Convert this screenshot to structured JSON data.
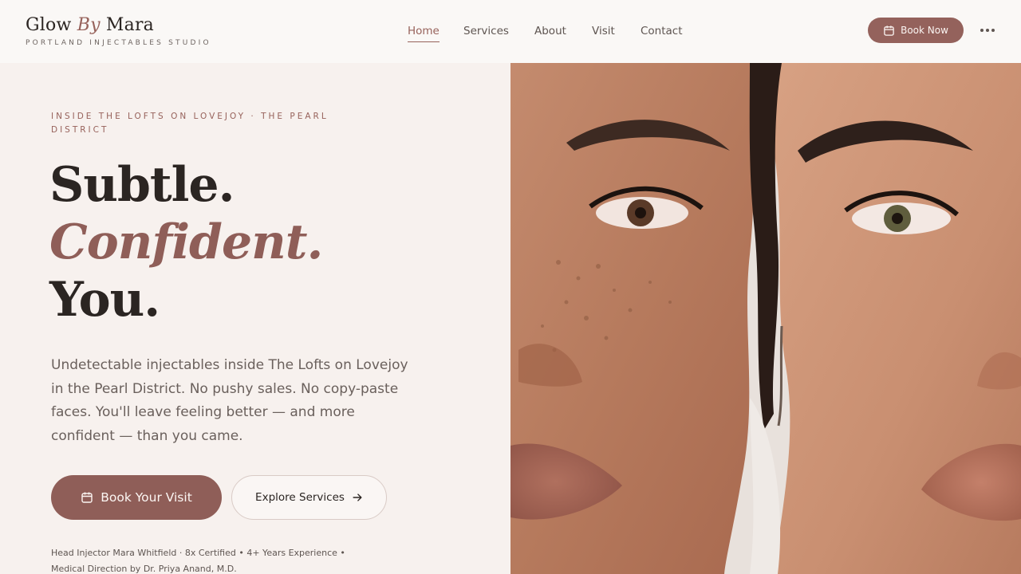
{
  "header": {
    "brand": {
      "name_part1": "Glow",
      "name_part2": "By",
      "name_part3": "Mara",
      "tagline": "PORTLAND INJECTABLES STUDIO"
    },
    "nav": [
      {
        "label": "Home",
        "active": true
      },
      {
        "label": "Services",
        "active": false
      },
      {
        "label": "About",
        "active": false
      },
      {
        "label": "Visit",
        "active": false
      },
      {
        "label": "Contact",
        "active": false
      }
    ],
    "book_now_label": "Book Now",
    "calendar_icon": "calendar-icon",
    "more_icon": "more-horizontal-icon"
  },
  "hero": {
    "eyebrow": "INSIDE THE LOFTS ON LOVEJOY · THE PEARL DISTRICT",
    "headline": {
      "line1": "Subtle.",
      "line2": "Confident.",
      "line3": "You."
    },
    "lede": "Undetectable injectables inside The Lofts on Lovejoy in the Pearl District. No pushy sales. No copy-paste faces. You'll leave feeling better — and more confident — than you came.",
    "primary_cta": "Book Your Visit",
    "secondary_cta": "Explore Services",
    "arrow_icon": "arrow-right-icon",
    "credentials_line1": "Head Injector Mara Whitfield · 8x Certified • 4+ Years Experience •",
    "credentials_line2": "Medical Direction by Dr. Priya Anand, M.D."
  },
  "photo": {
    "subject": "two-faces-closeup-image"
  },
  "colors": {
    "accent": "#8f5e58",
    "page_bg": "#f7f1ee",
    "header_bg": "#faf8f6",
    "text": "#2b2522",
    "muted": "#6a605c"
  }
}
